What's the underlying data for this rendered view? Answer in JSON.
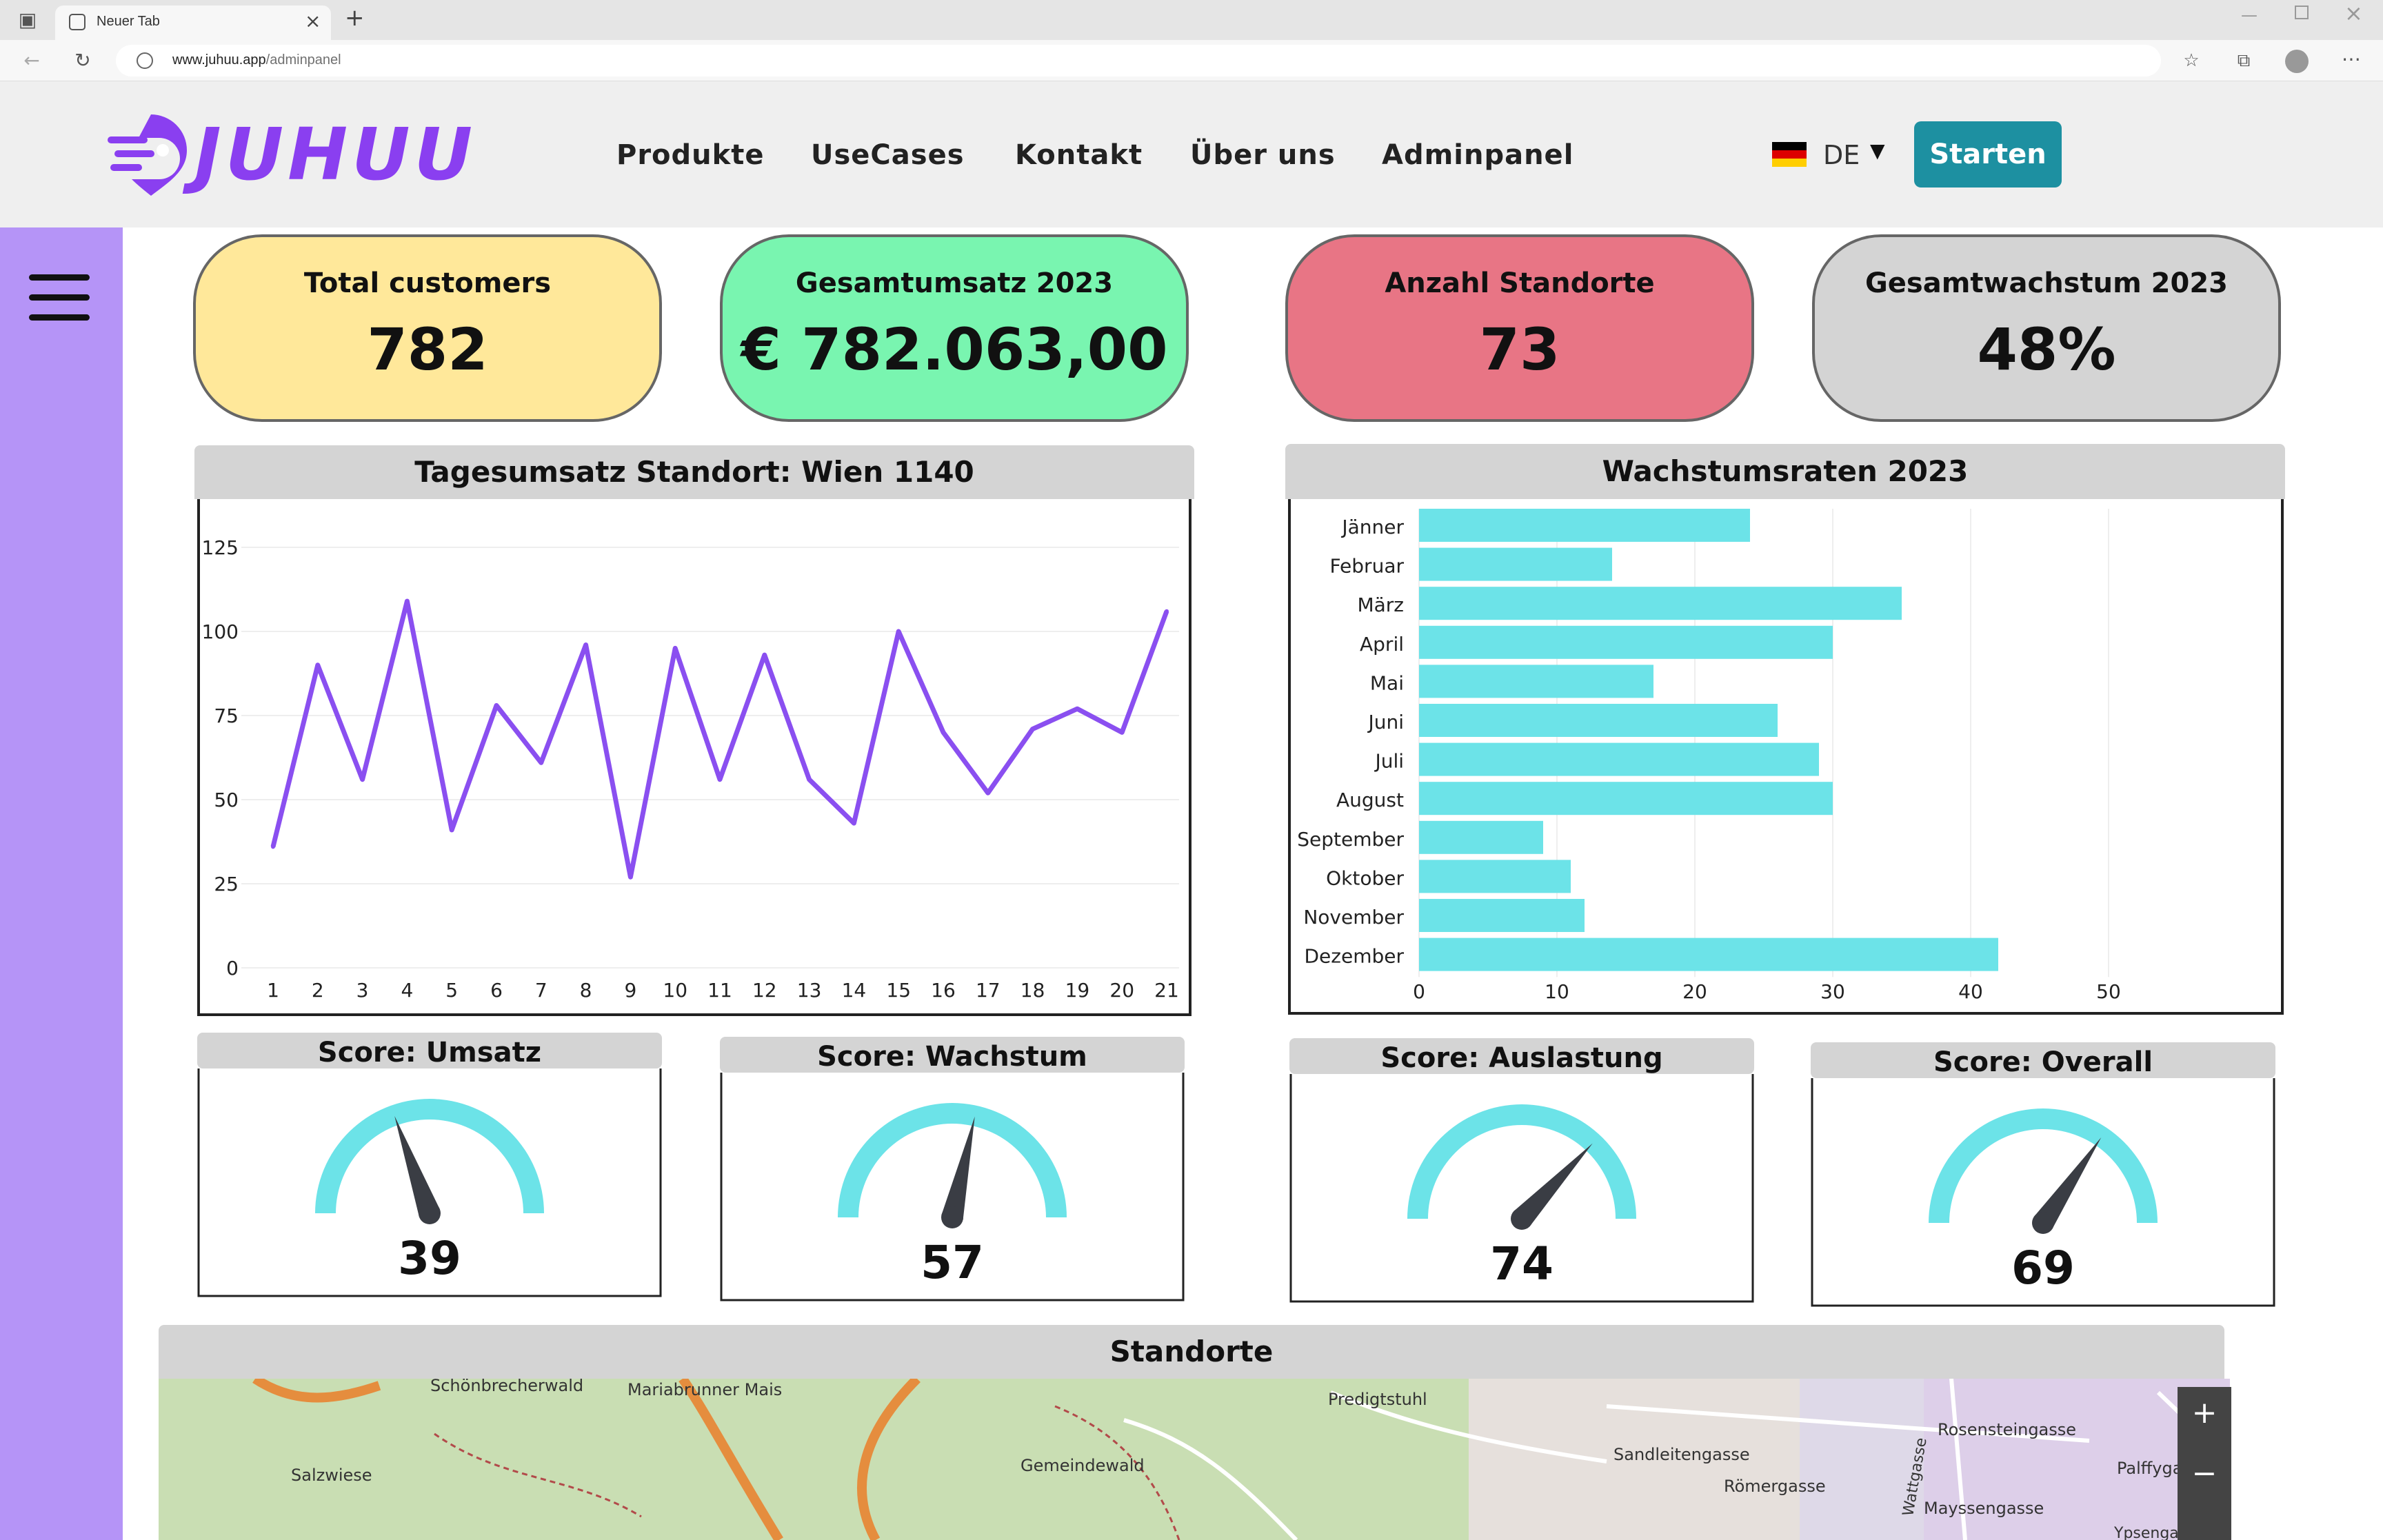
{
  "browser": {
    "tab_title": "Neuer Tab",
    "url_host": "www.juhuu.app",
    "url_path": "/adminpanel"
  },
  "header": {
    "logo_text": "JUHUU",
    "nav": [
      "Produkte",
      "UseCases",
      "Kontakt",
      "Über uns",
      "Adminpanel"
    ],
    "lang": "DE",
    "start_label": "Starten"
  },
  "kpis": [
    {
      "title": "Total customers",
      "value": "782",
      "color": "#ffe89a"
    },
    {
      "title": "Gesamtumsatz 2023",
      "value": "€ 782.063,00",
      "color": "#79f5b0"
    },
    {
      "title": "Anzahl Standorte",
      "value": "73",
      "color": "#e87585"
    },
    {
      "title": "Gesamtwachstum 2023",
      "value": "48%",
      "color": "#d4d4d4"
    }
  ],
  "colors": {
    "accent": "#8a3ff0",
    "line": "#8a4ff0",
    "bar": "#6ce3e8",
    "gauge": "#6ce3e8",
    "sidebar": "#b594f7",
    "button": "#1d90a1"
  },
  "chart_data": [
    {
      "type": "line",
      "title": "Tagesumsatz Standort: Wien 1140",
      "x": [
        1,
        2,
        3,
        4,
        5,
        6,
        7,
        8,
        9,
        10,
        11,
        12,
        13,
        14,
        15,
        16,
        17,
        18,
        19,
        20,
        21
      ],
      "series": [
        {
          "values": [
            36,
            90,
            56,
            109,
            41,
            78,
            61,
            96,
            27,
            95,
            56,
            93,
            56,
            43,
            100,
            70,
            52,
            71,
            77,
            70,
            106
          ]
        }
      ],
      "yticks": [
        0,
        25,
        50,
        75,
        100,
        125
      ],
      "ylim": [
        0,
        125
      ],
      "grid": true
    },
    {
      "type": "bar",
      "orientation": "horizontal",
      "title": "Wachstumsraten 2023",
      "categories": [
        "Jänner",
        "Februar",
        "März",
        "April",
        "Mai",
        "Juni",
        "Juli",
        "August",
        "September",
        "Oktober",
        "November",
        "Dezember"
      ],
      "values": [
        24,
        14,
        35,
        30,
        17,
        26,
        29,
        30,
        9,
        11,
        12,
        42
      ],
      "xticks": [
        0,
        10,
        20,
        30,
        40,
        50
      ],
      "xlim": [
        0,
        50
      ],
      "grid": true
    }
  ],
  "gauges": [
    {
      "title": "Score: Umsatz",
      "value": 39,
      "label": "39"
    },
    {
      "title": "Score: Wachstum",
      "value": 57,
      "label": "57"
    },
    {
      "title": "Score: Auslastung",
      "value": 74,
      "label": "74"
    },
    {
      "title": "Score: Overall",
      "value": 69,
      "label": "69"
    }
  ],
  "map": {
    "title": "Standorte",
    "zoom_in": "+",
    "zoom_out": "−",
    "labels": [
      "Schönbrecherwald",
      "Mariabrunner Mais",
      "Predigtstuhl",
      "Salzwiese",
      "Gemeindewald",
      "Sandleitengasse",
      "Römergasse",
      "Rosensteingasse",
      "Palffygasse",
      "Mayssengasse",
      "Wattgasse",
      "Ypsengasse"
    ]
  }
}
